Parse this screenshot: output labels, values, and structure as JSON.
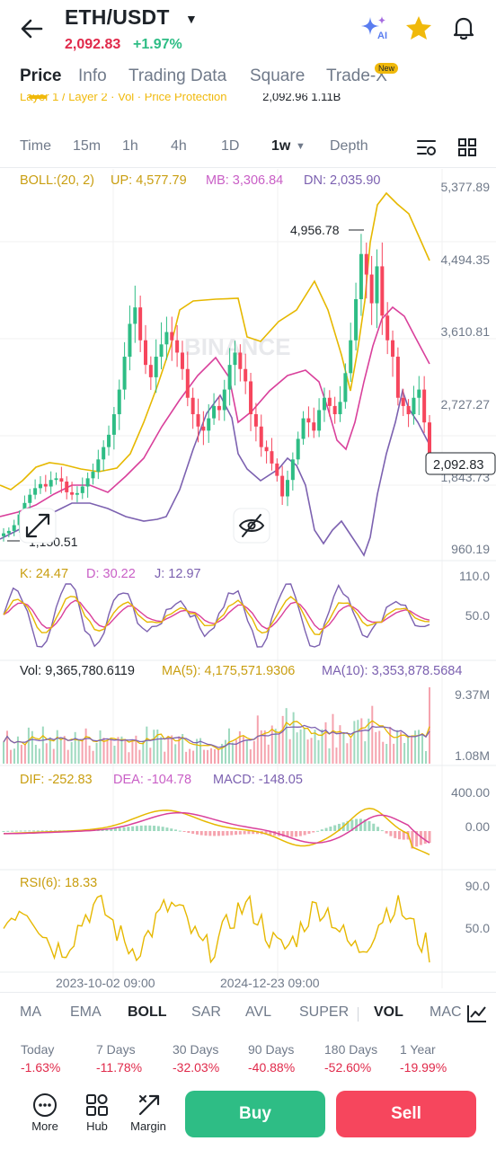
{
  "header": {
    "symbol": "ETH/USDT",
    "price": "2,092.83",
    "change": "+1.97%"
  },
  "tabs": [
    "Price",
    "Info",
    "Trading Data",
    "Square",
    "Trade-X"
  ],
  "new_badge": "New",
  "ticker_strip": {
    "items": "Layer 1 / Layer 2 · Vol · Price Protection",
    "values": "2,092.96   1.11B"
  },
  "intervals": [
    "Time",
    "15m",
    "1h",
    "4h",
    "1D",
    "1w",
    "Depth"
  ],
  "active_interval": "1w",
  "chart": {
    "boll_header": {
      "params": "BOLL:(20, 2)",
      "up": "UP: 4,577.79",
      "mb": "MB: 3,306.84",
      "dn": "DN: 2,035.90"
    },
    "price_axis": [
      "5,377.89",
      "4,494.35",
      "3,610.81",
      "2,727.27",
      "1,843.73",
      "960.19"
    ],
    "high_marker": "4,956.78",
    "low_marker": "1,150.51",
    "current_price_tag": "2,092.83",
    "watermark": "BINANCE",
    "kdj": {
      "k": "K: 24.47",
      "d": "D: 30.22",
      "j": "J: 12.97",
      "axis": [
        "110.0",
        "50.0"
      ]
    },
    "vol": {
      "vol": "Vol: 9,365,780.6119",
      "ma5": "MA(5): 4,175,571.9306",
      "ma10": "MA(10): 3,353,878.5684",
      "axis": [
        "9.37M",
        "1.08M"
      ]
    },
    "macd": {
      "dif": "DIF: -252.83",
      "dea": "DEA: -104.78",
      "macd": "MACD: -148.05",
      "axis": [
        "400.00",
        "0.00"
      ]
    },
    "rsi": {
      "rsi": "RSI(6): 18.33",
      "axis": [
        "90.0",
        "50.0"
      ]
    },
    "dates": [
      "2023-10-02 09:00",
      "2024-12-23 09:00"
    ]
  },
  "chart_data": {
    "type": "candlestick",
    "interval": "1w",
    "price_range": [
      960.19,
      5377.89
    ],
    "close_series": [
      1150,
      1180,
      1250,
      1380,
      1520,
      1620,
      1700,
      1750,
      1720,
      1800,
      1820,
      1780,
      1650,
      1620,
      1640,
      1720,
      1820,
      1900,
      2050,
      2200,
      2350,
      2600,
      2900,
      3300,
      3700,
      3900,
      3500,
      3200,
      3050,
      3300,
      3450,
      3600,
      3500,
      3350,
      3150,
      2800,
      2600,
      2450,
      2400,
      2550,
      2700,
      2650,
      2900,
      3200,
      3350,
      3150,
      3000,
      2600,
      2450,
      2200,
      2150,
      2000,
      1850,
      1600,
      1800,
      2050,
      2300,
      2550,
      2500,
      2400,
      2650,
      2800,
      2700,
      2600,
      2750,
      3100,
      3500,
      4000,
      4550,
      4300,
      3950,
      4400,
      3800,
      3500,
      3300,
      2800,
      2700,
      2600,
      2800,
      2900,
      2500,
      2092.83
    ],
    "boll": {
      "up": 4577.79,
      "mb": 3306.84,
      "dn": 2035.9
    },
    "kdj": {
      "k": 24.47,
      "d": 30.22,
      "j": 12.97
    },
    "volume": {
      "vol": 9365780.6119,
      "ma5": 4175571.9306,
      "ma10": 3353878.5684
    },
    "macd": {
      "dif": -252.83,
      "dea": -104.78,
      "macd": -148.05
    },
    "rsi6": 18.33
  },
  "indicator_tabs": [
    "MA",
    "EMA",
    "BOLL",
    "SAR",
    "AVL",
    "SUPER",
    "VOL",
    "MACD"
  ],
  "performance": [
    {
      "label": "Today",
      "value": "-1.63%"
    },
    {
      "label": "7 Days",
      "value": "-11.78%"
    },
    {
      "label": "30 Days",
      "value": "-32.03%"
    },
    {
      "label": "90 Days",
      "value": "-40.88%"
    },
    {
      "label": "180 Days",
      "value": "-52.60%"
    },
    {
      "label": "1 Year",
      "value": "-19.99%"
    }
  ],
  "bottom": {
    "more": "More",
    "hub": "Hub",
    "margin": "Margin",
    "buy": "Buy",
    "sell": "Sell"
  },
  "colors": {
    "up": "#2ebd85",
    "down": "#f6465d",
    "accent": "#f0b90b",
    "ma_purple": "#9b6fc3",
    "ma_pink": "#d9409b"
  }
}
